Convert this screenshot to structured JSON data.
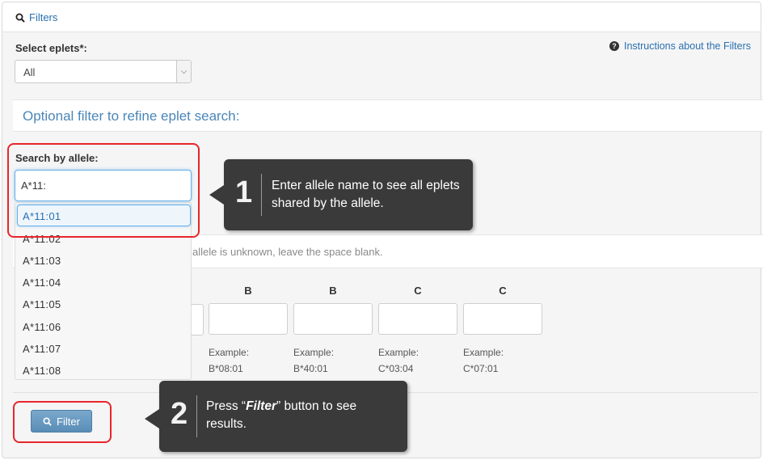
{
  "header": {
    "title": "Filters",
    "icon": "search-icon"
  },
  "eplets": {
    "label": "Select eplets*:",
    "selected": "All"
  },
  "instructions_link": "Instructions about the Filters",
  "optional_title": "Optional filter to refine eplet search:",
  "allele_search": {
    "label": "Search by allele:",
    "value": "A*11:",
    "suggestions": [
      "A*11:01",
      "A*11:02",
      "A*11:03",
      "A*11:04",
      "A*11:05",
      "A*11:06",
      "A*11:07",
      "A*11:08"
    ]
  },
  "hint_text": "allele is unknown, leave the space blank.",
  "locus_columns": [
    {
      "head": "B",
      "example_label": "Example:",
      "example_value": "B*08:01"
    },
    {
      "head": "B",
      "example_label": "Example:",
      "example_value": "B*40:01"
    },
    {
      "head": "C",
      "example_label": "Example:",
      "example_value": "C*03:04"
    },
    {
      "head": "C",
      "example_label": "Example:",
      "example_value": "C*07:01"
    }
  ],
  "filter_button": "Filter",
  "callout1": {
    "number": "1",
    "text": "Enter allele name to see all eplets shared by the allele."
  },
  "callout2": {
    "number": "2",
    "text_prefix": "Press “",
    "text_em": "Filter",
    "text_suffix": "” button to see results."
  },
  "colors": {
    "link": "#2a6fb0",
    "highlight": "#e8252a",
    "callout_bg": "#3a3a3a",
    "button": "#5a8db6"
  }
}
